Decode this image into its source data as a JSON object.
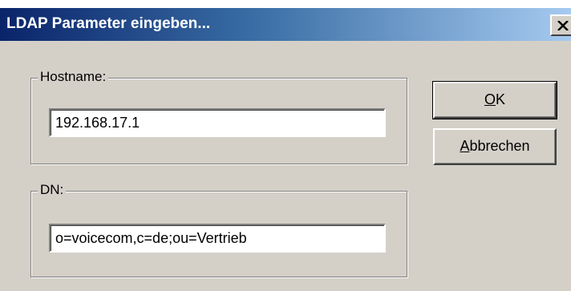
{
  "dialog": {
    "title": "LDAP Parameter eingeben...",
    "close_icon": "close-icon"
  },
  "hostname": {
    "label": "Hostname:",
    "value": "192.168.17.1"
  },
  "dn": {
    "label": "DN:",
    "value": "o=voicecom,c=de;ou=Vertrieb"
  },
  "buttons": {
    "ok_mnemonic": "O",
    "ok_rest": "K",
    "cancel_mnemonic": "A",
    "cancel_rest": "bbrechen"
  },
  "colors": {
    "titlebar_start": "#0a246a",
    "titlebar_end": "#a6caf0",
    "face": "#d4d0c8"
  }
}
